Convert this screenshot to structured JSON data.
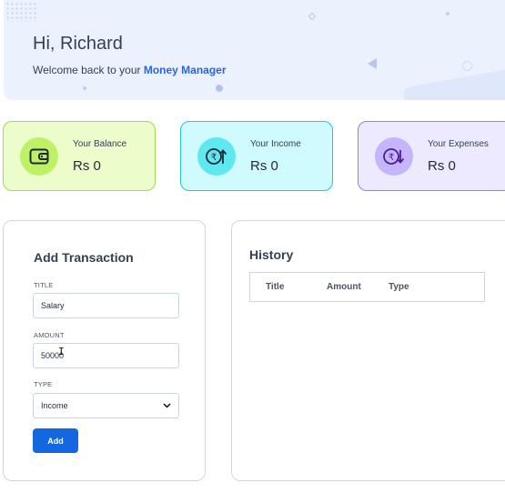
{
  "header": {
    "greeting": "Hi, Richard",
    "welcome_prefix": "Welcome back to your",
    "brand": "Money Manager",
    "brand_color": "#2563eb"
  },
  "summary": [
    {
      "label": "Your Balance",
      "value": "Rs 0",
      "icon": "wallet-icon",
      "color": "#bef264"
    },
    {
      "label": "Your Income",
      "value": "Rs 0",
      "icon": "rupee-up-icon",
      "color": "#5ee8f0"
    },
    {
      "label": "Your Expenses",
      "value": "Rs 0",
      "icon": "rupee-down-icon",
      "color": "#c4b5fd"
    }
  ],
  "form": {
    "title": "Add Transaction",
    "title_label": "TITLE",
    "title_value": "Salary",
    "amount_label": "AMOUNT",
    "amount_value": "50000",
    "type_label": "TYPE",
    "type_value": "Income",
    "submit_label": "Add",
    "accent": "#1467e0"
  },
  "history": {
    "title": "History",
    "columns": [
      "Title",
      "Amount",
      "Type"
    ]
  }
}
